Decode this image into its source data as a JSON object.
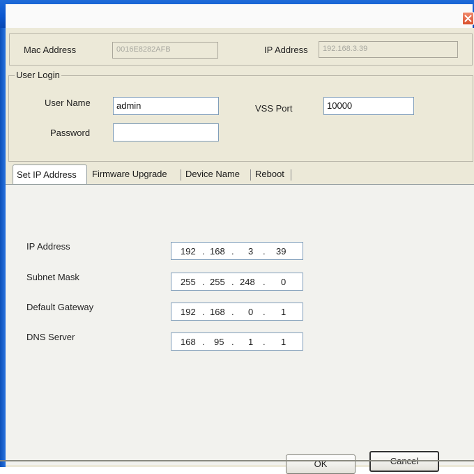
{
  "window": {
    "close_icon": "close-x-icon"
  },
  "device": {
    "mac_label": "Mac Address",
    "mac_value": "0016E8282AFB",
    "ip_label": "IP Address",
    "ip_value": "192.168.3.39"
  },
  "login": {
    "group_label": "User Login",
    "user_label": "User Name",
    "user_value": "admin",
    "password_label": "Password",
    "password_value": "",
    "port_label": "VSS Port",
    "port_value": "10000"
  },
  "tabs": [
    {
      "label": "Set IP Address",
      "active": true
    },
    {
      "label": "Firmware Upgrade",
      "active": false
    },
    {
      "label": "Device Name",
      "active": false
    },
    {
      "label": "Reboot",
      "active": false
    }
  ],
  "network": {
    "ip": {
      "label": "IP Address",
      "octets": [
        "192",
        "168",
        "3",
        "39"
      ]
    },
    "mask": {
      "label": "Subnet Mask",
      "octets": [
        "255",
        "255",
        "248",
        "0"
      ]
    },
    "gateway": {
      "label": "Default Gateway",
      "octets": [
        "192",
        "168",
        "0",
        "1"
      ]
    },
    "dns": {
      "label": "DNS Server",
      "octets": [
        "168",
        "95",
        "1",
        "1"
      ]
    }
  },
  "buttons": {
    "ok": "OK",
    "cancel": "Cancel"
  },
  "colors": {
    "titlebar": "#0b57d0",
    "dialog_bg": "#ece9d8",
    "close_button": "#d9502d"
  }
}
